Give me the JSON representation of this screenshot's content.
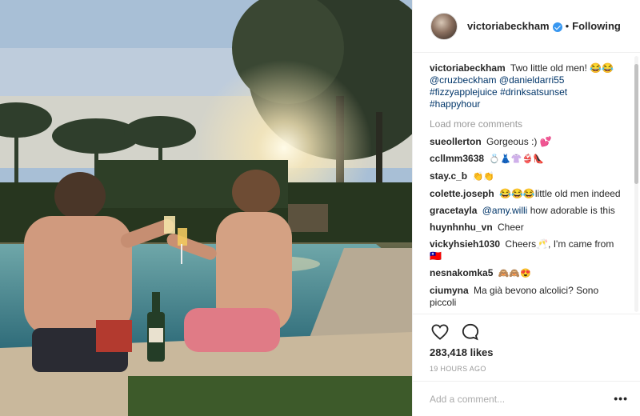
{
  "post": {
    "username": "victoriabeckham",
    "follow_state": "Following",
    "separator": "•"
  },
  "caption": {
    "username": "victoriabeckham",
    "text": "Two little old men! 😂😂",
    "tags": [
      "@cruzbeckham",
      "@danieldarri55",
      "#fizzyapplejuice",
      "#drinksatsunset",
      "#happyhour"
    ]
  },
  "load_more": "Load more comments",
  "comments": [
    {
      "user": "sueollerton",
      "text": "Gorgeous :) 💕"
    },
    {
      "user": "ccllmm3638",
      "text": "💍👗👚👙👠"
    },
    {
      "user": "stay.c_b",
      "text": "👏👏"
    },
    {
      "user": "colette.joseph",
      "text": "😂😂😂little old men indeed"
    },
    {
      "user": "gracetayla",
      "mention": "@amy.willi",
      "text": "how adorable is this"
    },
    {
      "user": "huynhnhu_vn",
      "text": "Cheer"
    },
    {
      "user": "vickyhsieh1030",
      "text": "Cheers🥂, I'm came from 🇹🇼"
    },
    {
      "user": "nesnakomka5",
      "text": "🙈🙈😍"
    },
    {
      "user": "ciumyna",
      "text": "Ma già bevono alcolici? Sono piccoli"
    }
  ],
  "likes": "283,418 likes",
  "time_ago": "19 HOURS AGO",
  "add_comment": {
    "placeholder": "Add a comment..."
  },
  "icons": {
    "like": "heart-icon",
    "comment": "speech-bubble-icon",
    "more": "more-options-icon"
  },
  "colors": {
    "link": "#003569",
    "verified": "#3897f0",
    "muted": "#999999"
  }
}
